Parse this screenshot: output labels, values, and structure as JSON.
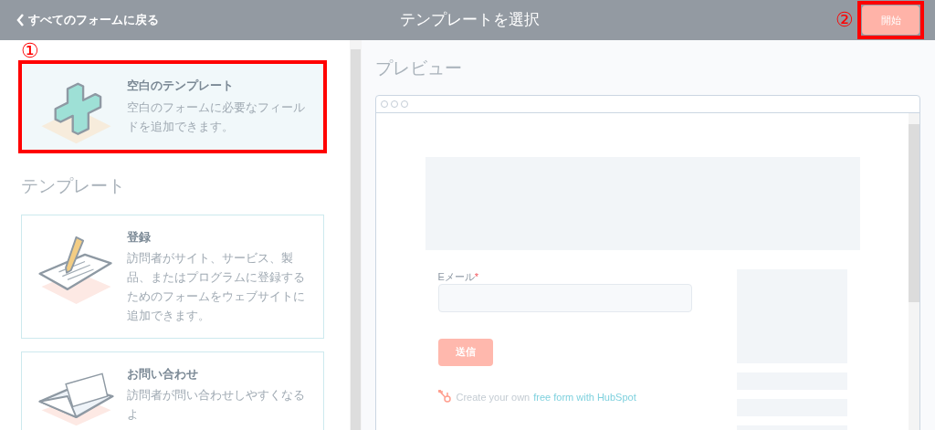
{
  "header": {
    "back_link": "すべてのフォームに戻る",
    "title": "テンプレートを選択",
    "start_button": "開始"
  },
  "annotations": [
    "①",
    "②"
  ],
  "blank_template": {
    "title": "空白のテンプレート",
    "description": "空白のフォームに必要なフィールドを追加できます。",
    "selected": true
  },
  "templates_heading": "テンプレート",
  "templates": [
    {
      "kind": "registration",
      "title": "登録",
      "description": "訪問者がサイト、サービス、製品、またはプログラムに登録するためのフォームをウェブサイトに追加できます。",
      "selected": false
    },
    {
      "kind": "contact",
      "title": "お問い合わせ",
      "description": "訪問者が問い合わせしやすくなるよ",
      "selected": false
    }
  ],
  "preview": {
    "heading": "プレビュー",
    "field_label": "Eメール",
    "required_mark": "*",
    "submit_button": "送信",
    "footer_text": "Create your own",
    "footer_link": "free form with HubSpot"
  }
}
